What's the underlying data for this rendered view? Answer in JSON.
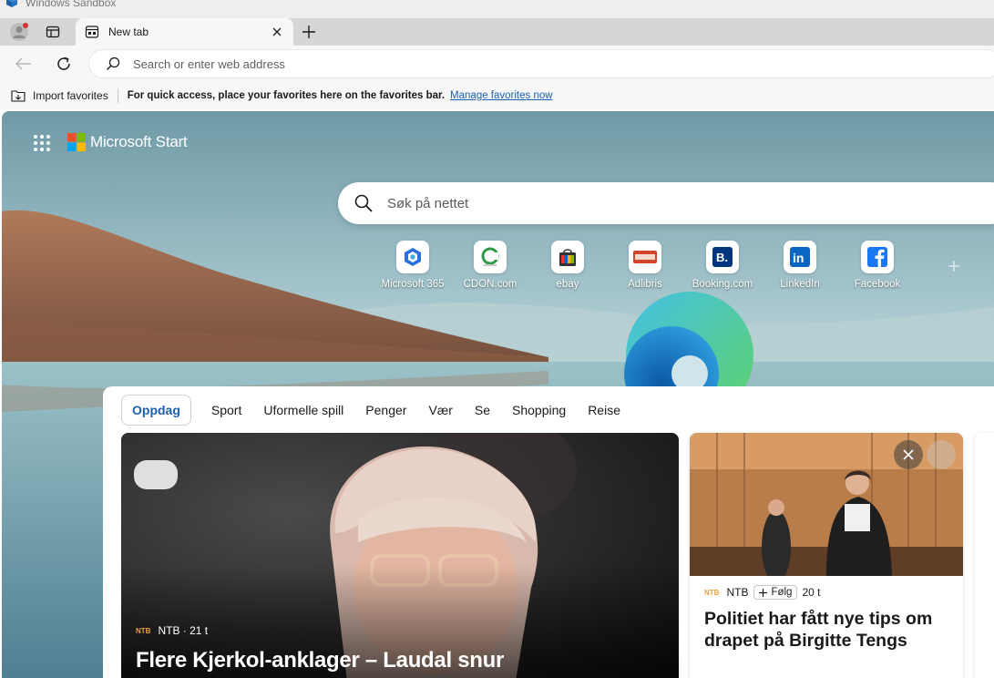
{
  "window": {
    "title": "Windows Sandbox"
  },
  "tabs": [
    {
      "title": "New tab",
      "active": true
    }
  ],
  "address_bar": {
    "placeholder": "Search or enter web address"
  },
  "favorites_bar": {
    "import_label": "Import favorites",
    "hint": "For quick access, place your favorites here on the favorites bar.",
    "manage_link": "Manage favorites now"
  },
  "start_page": {
    "brand": "Microsoft Start",
    "search_placeholder": "Søk på nettet",
    "quick_links": [
      {
        "label": "Microsoft 365",
        "icon": "microsoft-365-icon"
      },
      {
        "label": "CDON.com",
        "icon": "cdon-icon"
      },
      {
        "label": "ebay",
        "icon": "ebay-icon"
      },
      {
        "label": "Adlibris",
        "icon": "adlibris-icon"
      },
      {
        "label": "Booking.com",
        "icon": "booking-icon"
      },
      {
        "label": "LinkedIn",
        "icon": "linkedin-icon"
      },
      {
        "label": "Facebook",
        "icon": "facebook-icon"
      }
    ],
    "add_shortcut_glyph": "+"
  },
  "feed": {
    "tabs": [
      "Oppdag",
      "Sport",
      "Uformelle spill",
      "Penger",
      "Vær",
      "Se",
      "Shopping",
      "Reise"
    ],
    "active_tab": "Oppdag",
    "hero": {
      "source_logo": "NTB",
      "source_meta": "NTB · 21 t",
      "title": "Flere Kjerkol-anklager – Laudal snur"
    },
    "side": {
      "source_logo": "NTB",
      "source": "NTB",
      "follow_label": "Følg",
      "time": "20 t",
      "title": "Politiet har fått nye tips om drapet på Birgitte Tengs"
    }
  },
  "colors": {
    "accent": "#1a5fb4",
    "tab_strip": "#d6d6d6",
    "toolbar": "#f7f7f7"
  }
}
